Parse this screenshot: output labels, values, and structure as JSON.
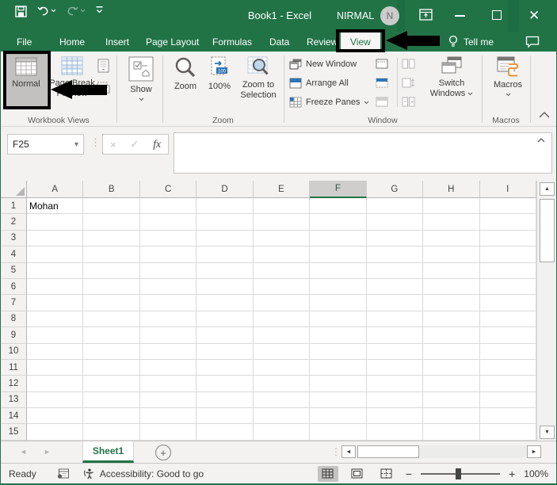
{
  "window": {
    "title": "Book1 - Excel",
    "user_name": "NIRMAL",
    "avatar_initial": "N"
  },
  "menu": {
    "items": [
      "File",
      "Home",
      "Insert",
      "Page Layout",
      "Formulas",
      "Data",
      "Review",
      "View"
    ],
    "active_item": "View",
    "tell_me": "Tell me"
  },
  "ribbon": {
    "workbook_views": {
      "group_label": "Workbook Views",
      "normal": "Normal",
      "page_break_preview": "Page Break Preview"
    },
    "show": {
      "button": "Show"
    },
    "zoom": {
      "group_label": "Zoom",
      "zoom": "Zoom",
      "percent": "100%",
      "zoom_to_selection": "Zoom to Selection"
    },
    "window": {
      "group_label": "Window",
      "new_window": "New Window",
      "arrange_all": "Arrange All",
      "freeze_panes": "Freeze Panes",
      "switch_line1": "Switch",
      "switch_line2": "Windows"
    },
    "macros": {
      "group_label": "Macros",
      "button": "Macros"
    }
  },
  "formula_bar": {
    "name_box": "F25",
    "fx": "fx"
  },
  "grid": {
    "columns": [
      "A",
      "B",
      "C",
      "D",
      "E",
      "F",
      "G",
      "H",
      "I"
    ],
    "selected_column": "F",
    "rows": [
      1,
      2,
      3,
      4,
      5,
      6,
      7,
      8,
      9,
      10,
      11,
      12,
      13,
      14,
      15
    ],
    "cells": {
      "A1": "Mohan"
    }
  },
  "sheet_bar": {
    "active_tab": "Sheet1"
  },
  "status_bar": {
    "mode": "Ready",
    "accessibility": "Accessibility: Good to go",
    "zoom_percent": "100%"
  },
  "icons": {
    "dropdown": "▾",
    "dots": "⋮",
    "cancel": "×",
    "enter": "✓",
    "up": "▲",
    "down": "▼",
    "left": "◄",
    "right": "►",
    "plus": "+",
    "minus": "−",
    "close": "✕"
  },
  "colors": {
    "excel_green": "#217346",
    "accent_blue": "#2e75b6",
    "macro_orange": "#e8943a"
  }
}
